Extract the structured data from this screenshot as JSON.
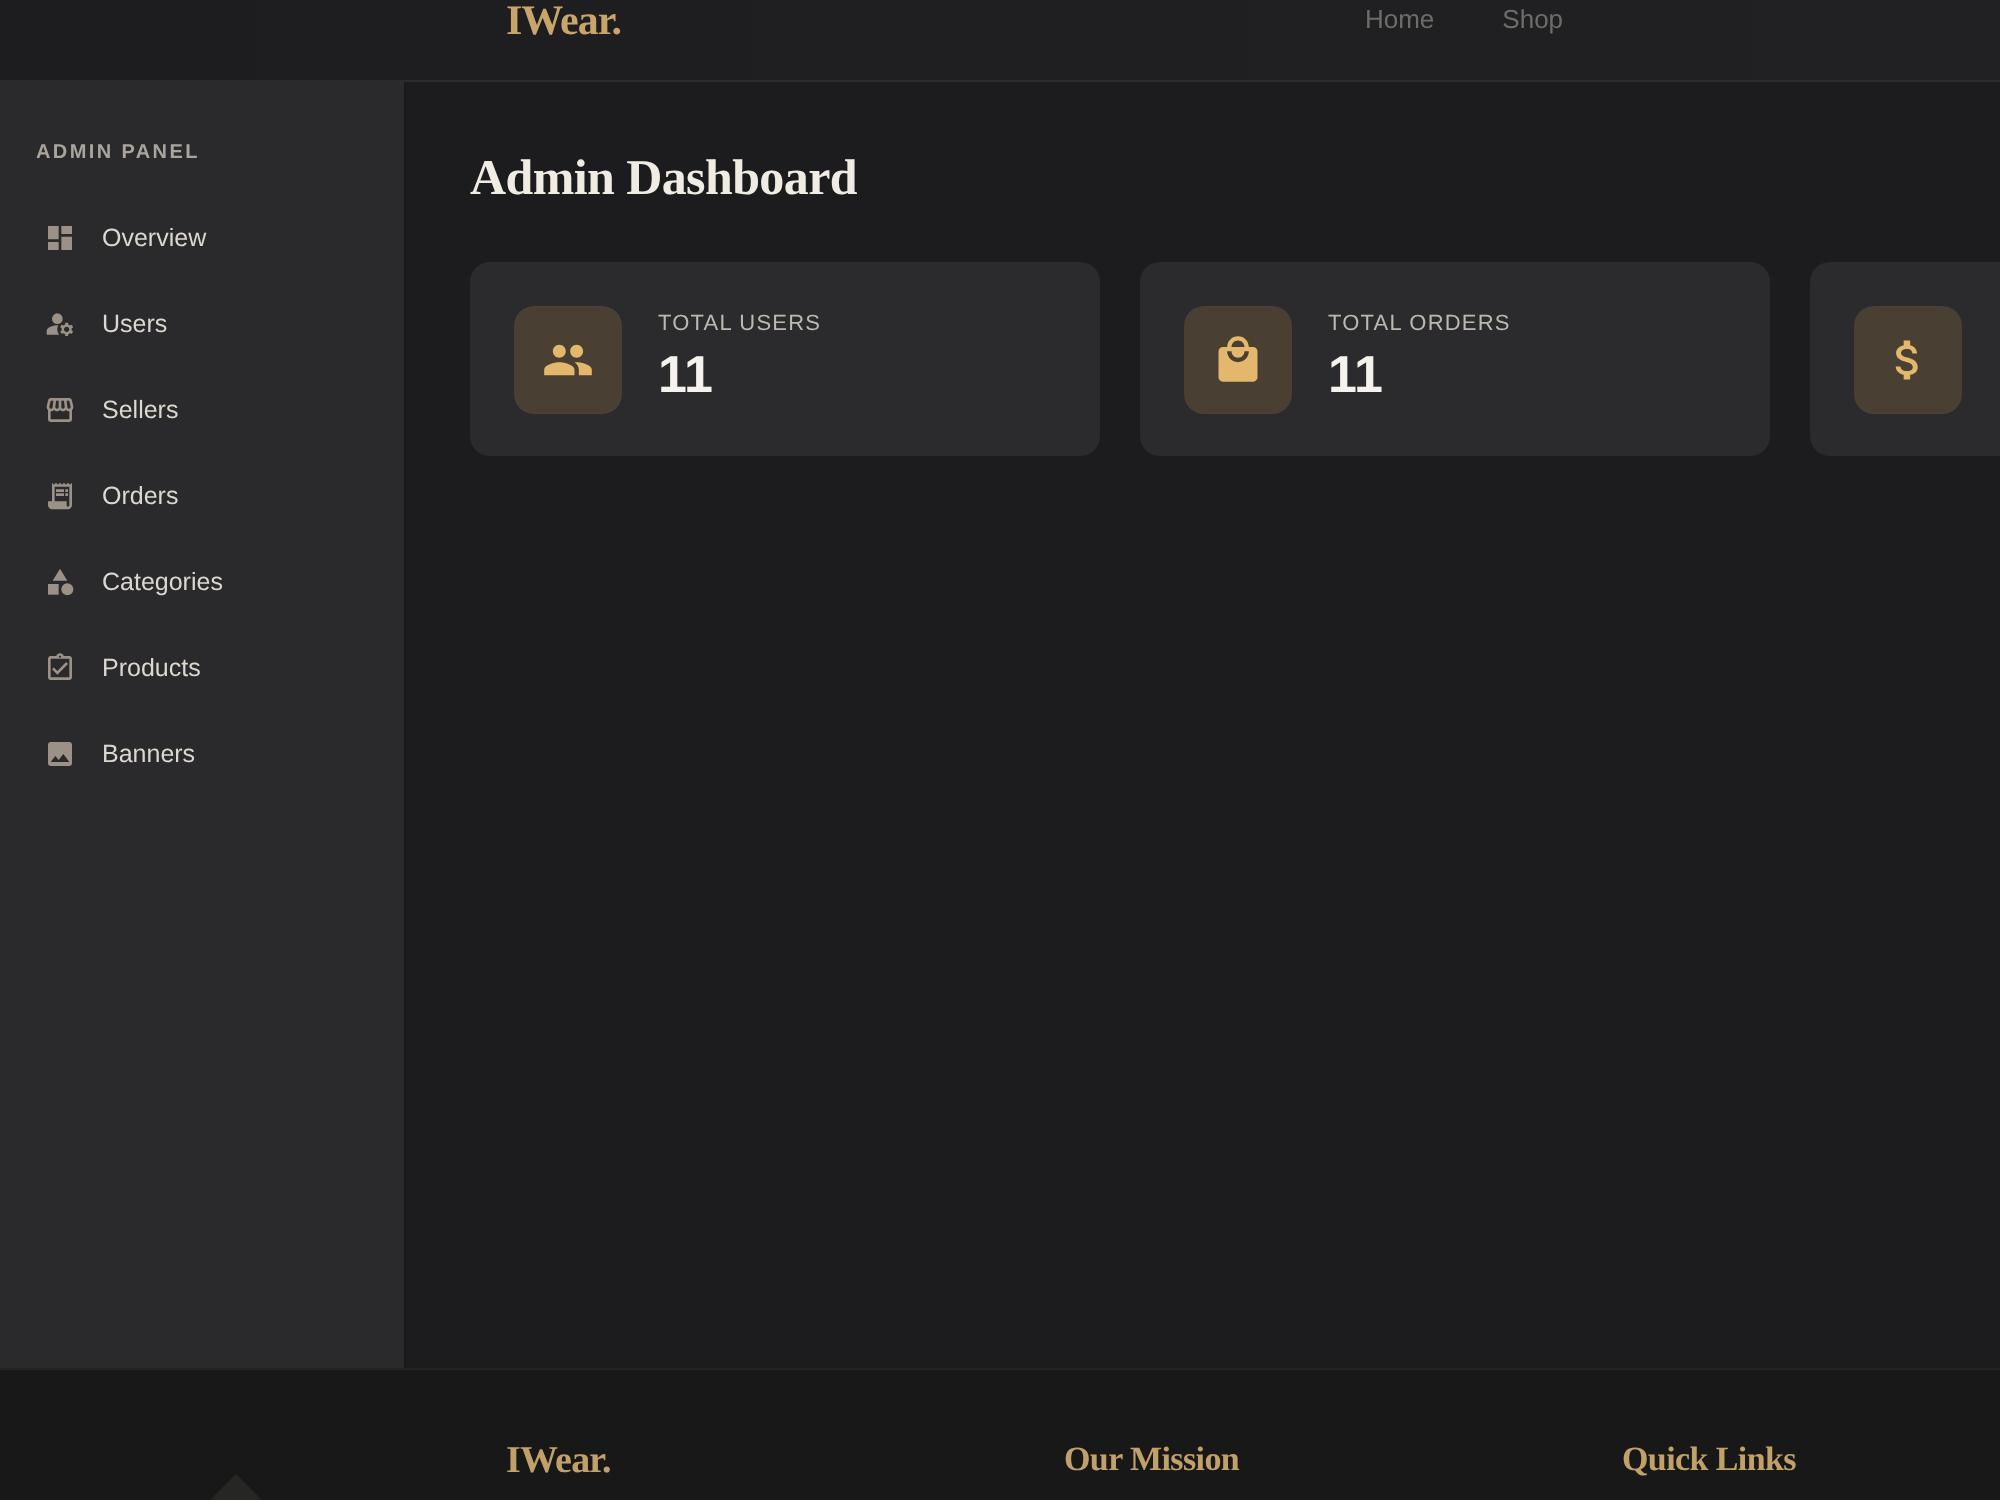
{
  "header": {
    "logo": "IWear.",
    "nav": [
      {
        "label": "Home"
      },
      {
        "label": "Shop"
      }
    ]
  },
  "sidebar": {
    "title": "ADMIN PANEL",
    "items": [
      {
        "label": "Overview"
      },
      {
        "label": "Users"
      },
      {
        "label": "Sellers"
      },
      {
        "label": "Orders"
      },
      {
        "label": "Categories"
      },
      {
        "label": "Products"
      },
      {
        "label": "Banners"
      }
    ]
  },
  "main": {
    "title": "Admin Dashboard",
    "stat_cards": [
      {
        "kind": "users",
        "label": "TOTAL USERS",
        "value": "11"
      },
      {
        "kind": "orders",
        "label": "TOTAL ORDERS",
        "value": "11"
      },
      {
        "kind": "money"
      }
    ]
  },
  "footer": {
    "logo": "IWear.",
    "headings": [
      "Our Mission",
      "Quick Links"
    ]
  }
}
